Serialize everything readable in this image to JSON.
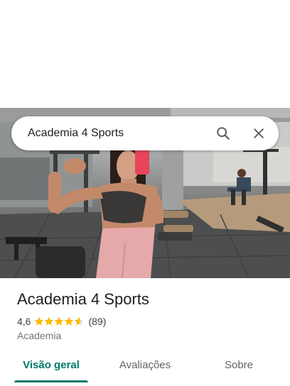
{
  "search": {
    "query": "Academia 4 Sports"
  },
  "icons": {
    "search": "search-icon",
    "close": "close-icon",
    "star": "star-icon"
  },
  "place": {
    "name": "Academia 4 Sports",
    "rating": "4,6",
    "rating_value": 4.6,
    "reviews_count": "(89)",
    "category": "Academia"
  },
  "photo": {
    "description_icon": "place-photo"
  },
  "tabs": [
    {
      "label": "Visão geral",
      "active": true
    },
    {
      "label": "Avaliações",
      "active": false
    },
    {
      "label": "Sobre",
      "active": false
    }
  ],
  "colors": {
    "accent": "#00796b",
    "star": "#fbbc04",
    "star_empty": "#dadce0"
  }
}
